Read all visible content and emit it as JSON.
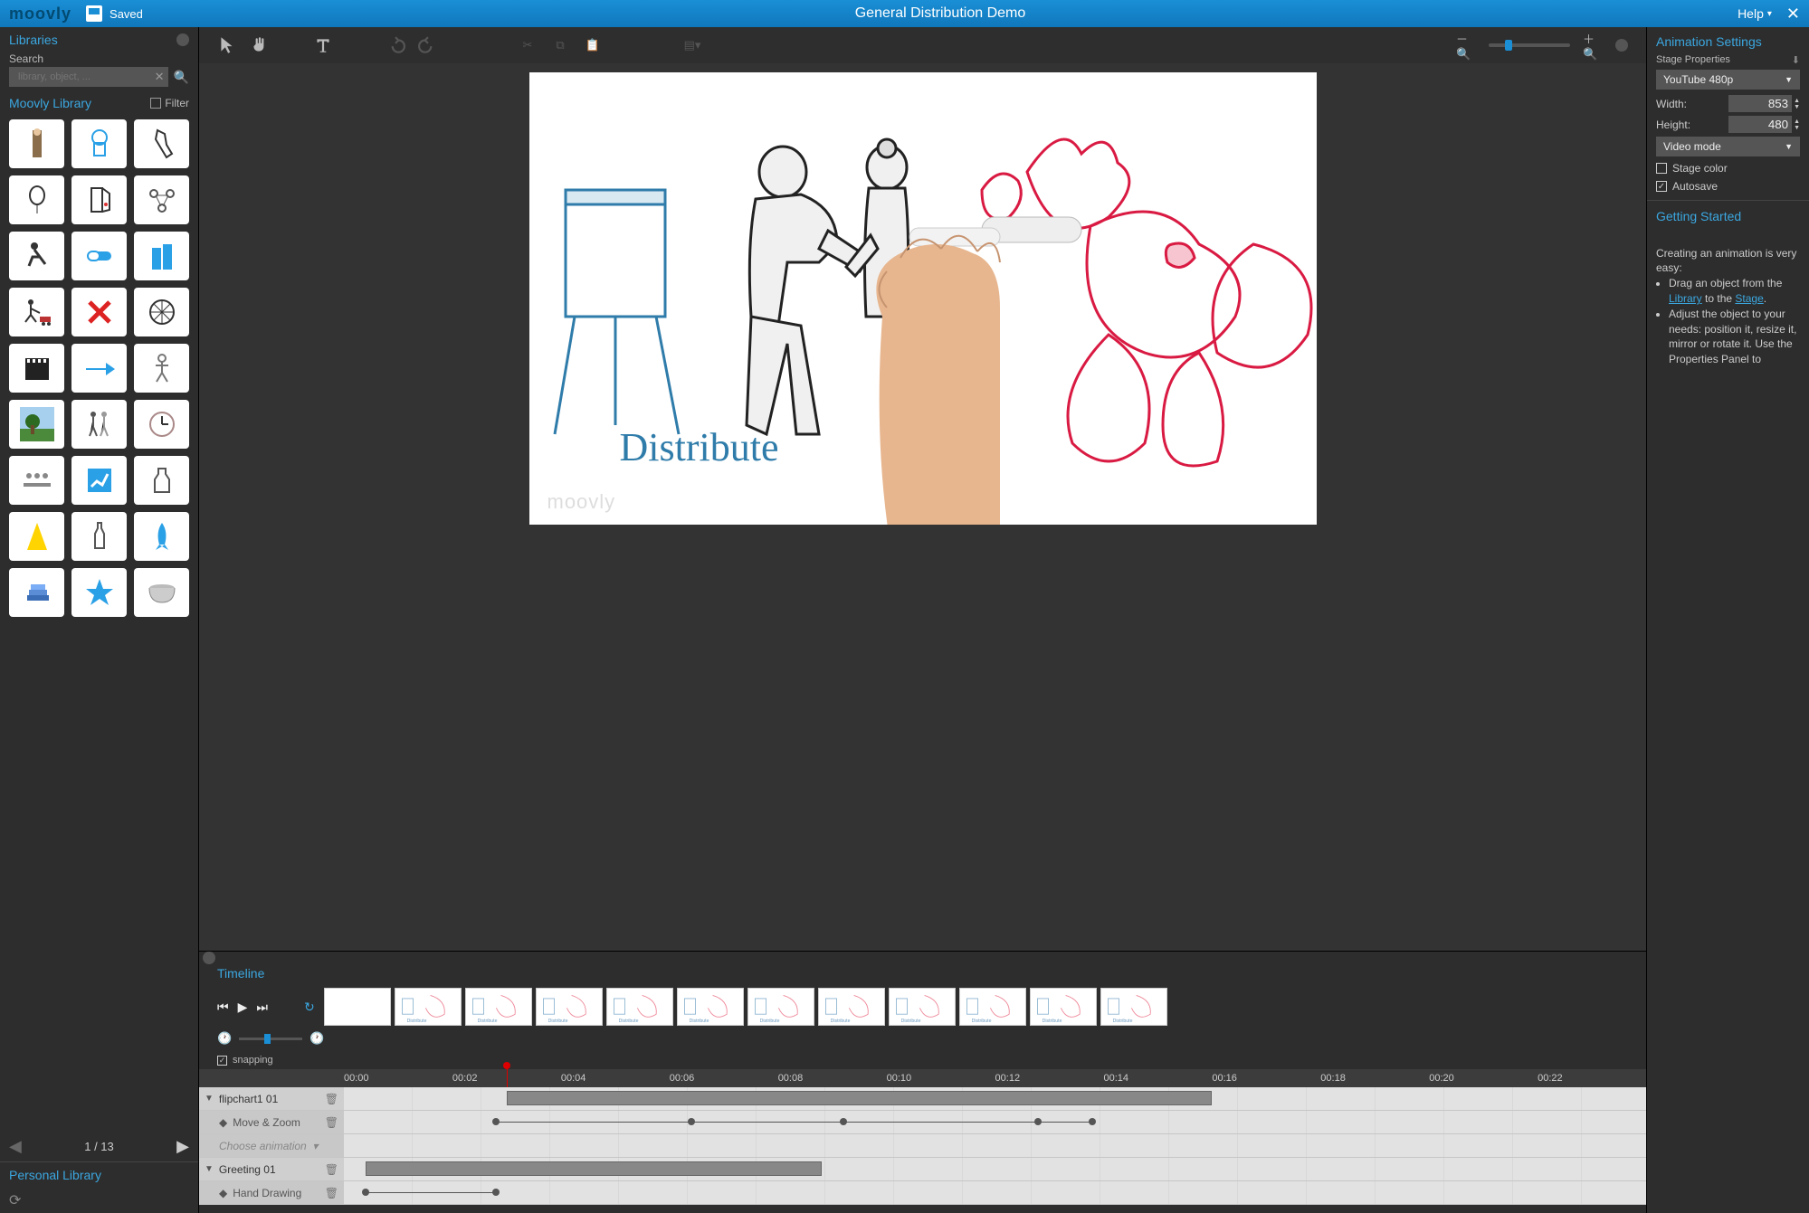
{
  "topbar": {
    "logo": "moovly",
    "save_status": "Saved",
    "title": "General Distribution Demo",
    "help": "Help"
  },
  "sidebar": {
    "libraries_label": "Libraries",
    "search_label": "Search",
    "search_placeholder": "library, object, ...",
    "library_title": "Moovly Library",
    "filter_label": "Filter",
    "page_indicator": "1 / 13",
    "personal_label": "Personal Library",
    "assets": [
      "man-standing",
      "blue-robot",
      "italy-outline",
      "balloon",
      "door-swing",
      "molecule",
      "running-boy",
      "pill-capsule",
      "buildings",
      "boy-wagon",
      "red-x",
      "wheel",
      "clapperboard",
      "blue-arrow",
      "human-figure",
      "tree-landscape",
      "walking-people",
      "clock",
      "meeting-sketch",
      "growth-chart",
      "milk-bottle",
      "yellow-spotlight",
      "bottle",
      "rocket",
      "book-stack",
      "star",
      "cooking-pot"
    ]
  },
  "stage": {
    "caption": "Distribute",
    "watermark": "moovly"
  },
  "right": {
    "anim_settings": "Animation Settings",
    "stage_props": "Stage Properties",
    "preset": "YouTube 480p",
    "width_label": "Width:",
    "width_value": "853",
    "height_label": "Height:",
    "height_value": "480",
    "video_mode": "Video mode",
    "stage_color": "Stage color",
    "autosave": "Autosave",
    "getting_started": "Getting Started",
    "gs_intro": "Creating an animation is very easy:",
    "gs_b1a": "Drag an object from the ",
    "gs_b1_link1": "Library",
    "gs_b1b": " to the ",
    "gs_b1_link2": "Stage",
    "gs_b1c": ".",
    "gs_b2": "Adjust the object to your needs: position it, resize it, mirror or rotate it. Use the Properties Panel to"
  },
  "timeline": {
    "title": "Timeline",
    "snapping": "snapping",
    "ticks": [
      "00:00",
      "00:02",
      "00:04",
      "00:06",
      "00:08",
      "00:10",
      "00:12",
      "00:14",
      "00:16",
      "00:18",
      "00:20",
      "00:22"
    ],
    "playhead_time_index": 1.5,
    "tracks": [
      {
        "name": "flipchart1 01",
        "type": "group",
        "clip_start": 1.5,
        "clip_end": 8
      },
      {
        "name": "Move & Zoom",
        "type": "anim",
        "kf": [
          1.4,
          3.2,
          4.6,
          6.4,
          6.9
        ]
      },
      {
        "name": "Choose animation",
        "type": "choose"
      },
      {
        "name": "Greeting 01",
        "type": "group",
        "clip_start": 0.2,
        "clip_end": 4.4
      },
      {
        "name": "Hand Drawing",
        "type": "anim",
        "kf": [
          0.2,
          1.4
        ]
      }
    ],
    "thumb_count": 12
  }
}
